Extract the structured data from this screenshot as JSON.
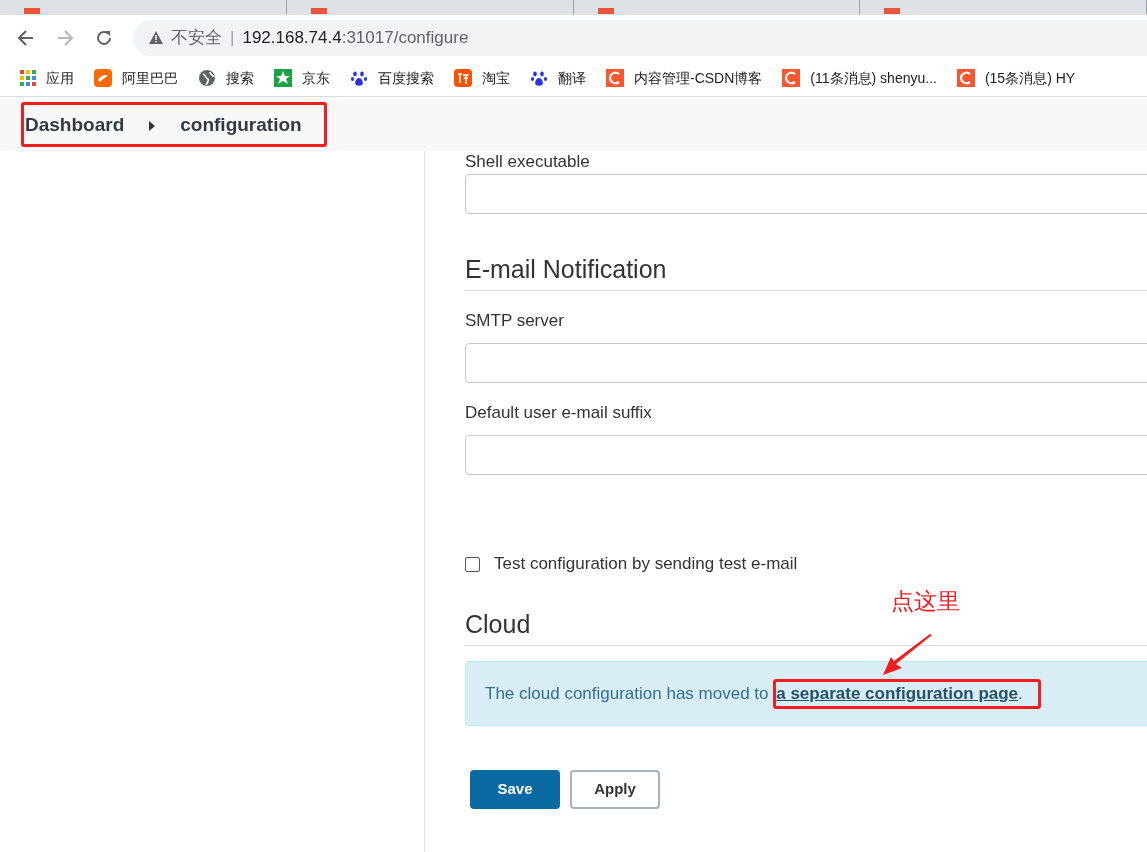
{
  "address_bar": {
    "security": "不安全",
    "separator": "|",
    "host": "192.168.74.4",
    "path": ":31017/configure"
  },
  "bookmarks": [
    {
      "kind": "apps",
      "label": "应用"
    },
    {
      "kind": "alibaba",
      "label": "阿里巴巴"
    },
    {
      "kind": "globe",
      "label": "搜索"
    },
    {
      "kind": "jd",
      "label": "京东"
    },
    {
      "kind": "baidu",
      "label": "百度搜索"
    },
    {
      "kind": "taobao",
      "label": "淘宝"
    },
    {
      "kind": "baidu",
      "label": "翻译"
    },
    {
      "kind": "csdn",
      "label": "内容管理-CSDN博客"
    },
    {
      "kind": "csdn",
      "label": "(11条消息) shenyu..."
    },
    {
      "kind": "csdn",
      "label": "(15条消息) HY"
    }
  ],
  "breadcrumb": [
    "Dashboard",
    "configuration"
  ],
  "shell": {
    "label": "Shell executable"
  },
  "email": {
    "heading": "E-mail Notification",
    "fields": [
      {
        "label": "SMTP server"
      },
      {
        "label": "Default user e-mail suffix"
      }
    ],
    "test_checkbox": {
      "label": "Test configuration by sending test e-mail",
      "checked": false
    }
  },
  "cloud": {
    "heading": "Cloud",
    "message": "The cloud configuration has moved to ",
    "link": "a separate configuration page",
    "after": "."
  },
  "buttons": [
    {
      "kind": "primary",
      "label": "Save"
    },
    {
      "kind": "secondary",
      "label": "Apply"
    }
  ],
  "annotation": {
    "note": "点这里"
  }
}
